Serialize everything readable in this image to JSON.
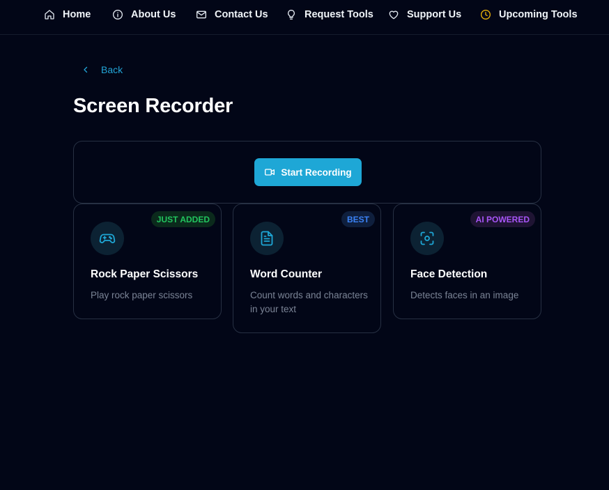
{
  "nav": [
    {
      "label": "Home",
      "icon": "home-icon"
    },
    {
      "label": "About Us",
      "icon": "info-icon"
    },
    {
      "label": "Contact Us",
      "icon": "mail-icon"
    },
    {
      "label": "Request Tools",
      "icon": "lightbulb-icon"
    },
    {
      "label": "Support Us",
      "icon": "heart-icon"
    },
    {
      "label": "Upcoming Tools",
      "icon": "clock-icon",
      "icon_color": "#eab308"
    }
  ],
  "back": {
    "label": "Back",
    "icon": "chevron-left-icon"
  },
  "page": {
    "title": "Screen Recorder"
  },
  "recorder": {
    "button_label": "Start Recording",
    "button_icon": "video-camera-icon",
    "accent": "#1ea7d6"
  },
  "cards": [
    {
      "title": "Rock Paper Scissors",
      "description": "Play rock paper scissors",
      "icon": "gamepad-icon",
      "badge": {
        "label": "JUST ADDED",
        "color": "#22c55e",
        "background": "#0b2a1c"
      }
    },
    {
      "title": "Word Counter",
      "description": "Count words and characters in your text",
      "icon": "document-icon",
      "badge": {
        "label": "BEST",
        "color": "#3b82f6",
        "background": "#0f1f3d"
      }
    },
    {
      "title": "Face Detection",
      "description": "Detects faces in an image",
      "icon": "face-scan-icon",
      "badge": {
        "label": "AI POWERED",
        "color": "#a855f7",
        "background": "#1f1433"
      }
    }
  ]
}
